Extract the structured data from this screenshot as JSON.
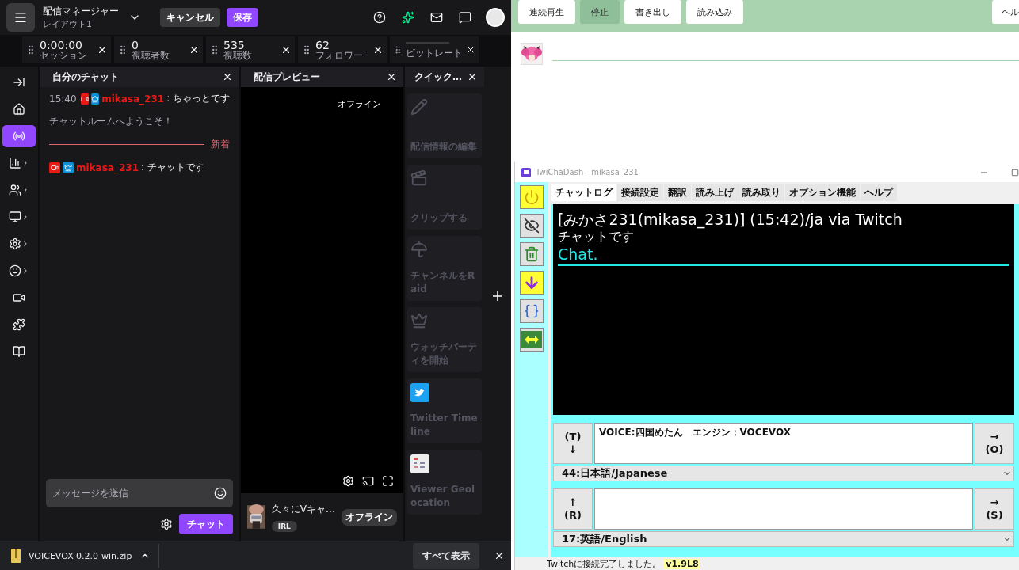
{
  "stream_manager": {
    "title": "配信マネージャー",
    "subtitle": "レイアウト1",
    "cancel_button": "キャンセル",
    "save_button": "保存",
    "stats": [
      {
        "value": "0:00:00",
        "label": "セッション"
      },
      {
        "value": "0",
        "label": "視聴者数"
      },
      {
        "value": "535",
        "label": "視聴数"
      },
      {
        "value": "62",
        "label": "フォロワー"
      },
      {
        "label": "ビットレート"
      }
    ],
    "sidebar": [
      {
        "kind": "collapse",
        "selected": false,
        "expandable": false
      },
      {
        "kind": "home",
        "selected": false,
        "expandable": false
      },
      {
        "kind": "broadcast",
        "selected": true,
        "expandable": false
      },
      {
        "kind": "analytics",
        "selected": false,
        "expandable": true
      },
      {
        "kind": "community",
        "selected": false,
        "expandable": true
      },
      {
        "kind": "content",
        "selected": false,
        "expandable": true
      },
      {
        "kind": "settings",
        "selected": false,
        "expandable": true
      },
      {
        "kind": "emotes",
        "selected": false,
        "expandable": true
      },
      {
        "kind": "video",
        "selected": false,
        "expandable": false
      },
      {
        "kind": "extensions",
        "selected": false,
        "expandable": false
      },
      {
        "kind": "guide",
        "selected": false,
        "expandable": false
      }
    ],
    "chat": {
      "title": "自分のチャット",
      "messages": [
        {
          "kind": "user",
          "time": "15:40",
          "user": "mikasa_231",
          "text": ": ちゃっとです"
        },
        {
          "kind": "system",
          "text": "チャットルームへようこそ！"
        },
        {
          "kind": "divider",
          "text": "新着"
        },
        {
          "kind": "user",
          "user": "mikasa_231",
          "text": ": チャットです"
        }
      ],
      "input_placeholder": "メッセージを送信",
      "send_button": "チャット"
    },
    "preview": {
      "title": "配信プレビュー",
      "status": "オフライン",
      "stream_title": "久々にVキャ…",
      "badge": "オフライン",
      "tag": "IRL"
    },
    "quick_actions": {
      "title": "クイック…",
      "actions": [
        {
          "kind": "edit",
          "label": "配信情報の編集"
        },
        {
          "kind": "clip",
          "label": "クリップする"
        },
        {
          "kind": "raid",
          "label": "チャンネルをRaid"
        },
        {
          "kind": "watch_party",
          "label": "ウォッチパーティを開始"
        },
        {
          "kind": "twitter",
          "label": "Twitter Timeline"
        },
        {
          "kind": "geolocation",
          "label": "Viewer Geolocation"
        }
      ]
    }
  },
  "download_bar": {
    "file": "VOICEVOX-0.2.0-win.zip",
    "show_all": "すべて表示"
  },
  "editor": {
    "toolbar": [
      {
        "label": "連続再生",
        "selected": false
      },
      {
        "label": "停止",
        "selected": true
      },
      {
        "label": "書き出し",
        "selected": false
      },
      {
        "label": "読み込み",
        "selected": false
      }
    ],
    "help_button": "ヘル"
  },
  "twichadash": {
    "title": "TwiChaDash - mikasa_231",
    "tools": [
      {
        "kind": "power",
        "on": true
      },
      {
        "kind": "mute",
        "on": false
      },
      {
        "kind": "trash",
        "on": false
      },
      {
        "kind": "scroll",
        "on": true
      },
      {
        "kind": "bracket",
        "on": false
      },
      {
        "kind": "swap",
        "on": false
      }
    ],
    "tabs": [
      {
        "label": "チャットログ",
        "selected": true
      },
      {
        "label": "接続設定",
        "selected": false
      },
      {
        "label": "翻訳",
        "selected": false
      },
      {
        "label": "読み上げ",
        "selected": false
      },
      {
        "label": "読み取り",
        "selected": false
      },
      {
        "label": "オプション機能",
        "selected": false
      },
      {
        "label": "ヘルプ",
        "selected": false
      }
    ],
    "log": [
      {
        "header": "[みかさ231(mikasa_231)] (15:42)/ja via Twitch",
        "text": "チャットです",
        "translation": "Chat."
      }
    ],
    "rows": [
      {
        "left": [
          "(T)",
          "↓"
        ],
        "value": "VOICE:四国めたん　エンジン：VOCEVOX",
        "right": [
          "→",
          "(O)"
        ],
        "language": "44:日本語/Japanese"
      },
      {
        "left": [
          "↑",
          "(R)"
        ],
        "right": [
          "→",
          "(S)"
        ],
        "language": "17:英語/English"
      }
    ],
    "status": "Twitchに接続完了しました。",
    "version": "v1.9L8"
  }
}
